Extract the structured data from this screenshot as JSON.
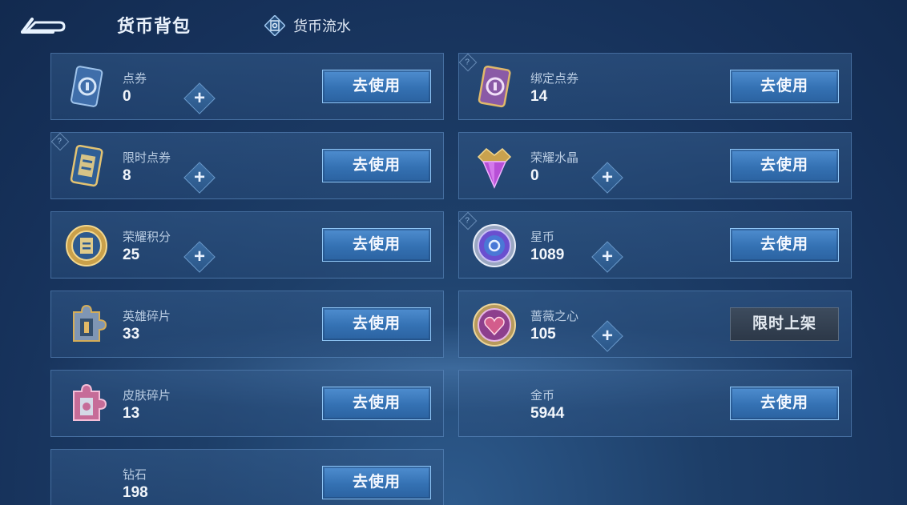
{
  "header": {
    "title": "货币背包",
    "flow_label": "货币流水"
  },
  "cards": [
    {
      "name": "点券",
      "count": "0",
      "button": "去使用",
      "icon": "coupon-icon"
    },
    {
      "name": "绑定点券",
      "count": "14",
      "button": "去使用",
      "icon": "bound-coupon-icon"
    },
    {
      "name": "限时点券",
      "count": "8",
      "button": "去使用",
      "icon": "limited-coupon-icon"
    },
    {
      "name": "荣耀水晶",
      "count": "0",
      "button": "去使用",
      "icon": "glory-crystal-icon"
    },
    {
      "name": "荣耀积分",
      "count": "25",
      "button": "去使用",
      "icon": "glory-points-icon"
    },
    {
      "name": "星币",
      "count": "1089",
      "button": "去使用",
      "icon": "star-coin-icon"
    },
    {
      "name": "英雄碎片",
      "count": "33",
      "button": "去使用",
      "icon": "hero-fragment-icon"
    },
    {
      "name": "蔷薇之心",
      "count": "105",
      "button": "限时上架",
      "icon": "rose-heart-icon"
    },
    {
      "name": "皮肤碎片",
      "count": "13",
      "button": "去使用",
      "icon": "skin-fragment-icon"
    },
    {
      "name": "金币",
      "count": "5944",
      "button": "去使用",
      "icon": ""
    },
    {
      "name": "钻石",
      "count": "198",
      "button": "去使用",
      "icon": ""
    }
  ],
  "help_mark": "?",
  "plus_mark": "+"
}
